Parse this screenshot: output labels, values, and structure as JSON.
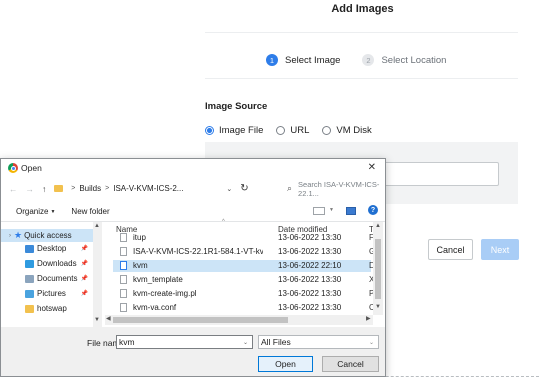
{
  "wizard": {
    "title": "Add Images",
    "steps": [
      {
        "number": "1",
        "label": "Select Image"
      },
      {
        "number": "2",
        "label": "Select Location"
      }
    ],
    "image_source_label": "Image Source",
    "radio_options": [
      {
        "label": "Image File",
        "selected": true
      },
      {
        "label": "URL",
        "selected": false
      },
      {
        "label": "VM Disk",
        "selected": false
      }
    ],
    "cancel_label": "Cancel",
    "next_label": "Next",
    "accent_color": "#2e7de9"
  },
  "dialog": {
    "title": "Open",
    "close_glyph": "✕",
    "nav": {
      "back": "←",
      "forward": "→",
      "up": "↑"
    },
    "breadcrumb": [
      "Builds",
      "ISA-V-KVM-ICS-2..."
    ],
    "refresh_glyph": "↻",
    "search_placeholder": "Search ISA-V-KVM-ICS-22.1...",
    "toolbar": {
      "organize": "Organize",
      "new_folder": "New folder"
    },
    "sidebar": [
      {
        "label": "Quick access",
        "icon": "star-icon",
        "selected": true
      },
      {
        "label": "Desktop",
        "icon": "desktop-folder-icon",
        "pinned": true
      },
      {
        "label": "Downloads",
        "icon": "downloads-folder-icon",
        "pinned": true
      },
      {
        "label": "Documents",
        "icon": "documents-folder-icon",
        "pinned": true
      },
      {
        "label": "Pictures",
        "icon": "pictures-folder-icon",
        "pinned": true
      },
      {
        "label": "hotswap",
        "icon": "folder-icon",
        "pinned": false
      }
    ],
    "columns": {
      "name": "Name",
      "date": "Date modified",
      "type": "Typ"
    },
    "files": [
      {
        "name": "itup",
        "date": "13-06-2022 13:30",
        "type": "File"
      },
      {
        "name": "ISA-V-KVM-ICS-22.1R1-584.1-VT-kvm.im...",
        "date": "13-06-2022 13:30",
        "type": "GZ"
      },
      {
        "name": "kvm",
        "date": "13-06-2022 22:10",
        "type": "Dr",
        "selected": true
      },
      {
        "name": "kvm_template",
        "date": "13-06-2022 13:30",
        "type": "XM"
      },
      {
        "name": "kvm-create-img.pl",
        "date": "13-06-2022 13:30",
        "type": "PL"
      },
      {
        "name": "kvm-va.conf",
        "date": "13-06-2022 13:30",
        "type": "CC"
      }
    ],
    "file_name_label": "File name:",
    "file_name_value": "kvm",
    "file_type_value": "All Files",
    "open_label": "Open",
    "cancel_label": "Cancel"
  }
}
